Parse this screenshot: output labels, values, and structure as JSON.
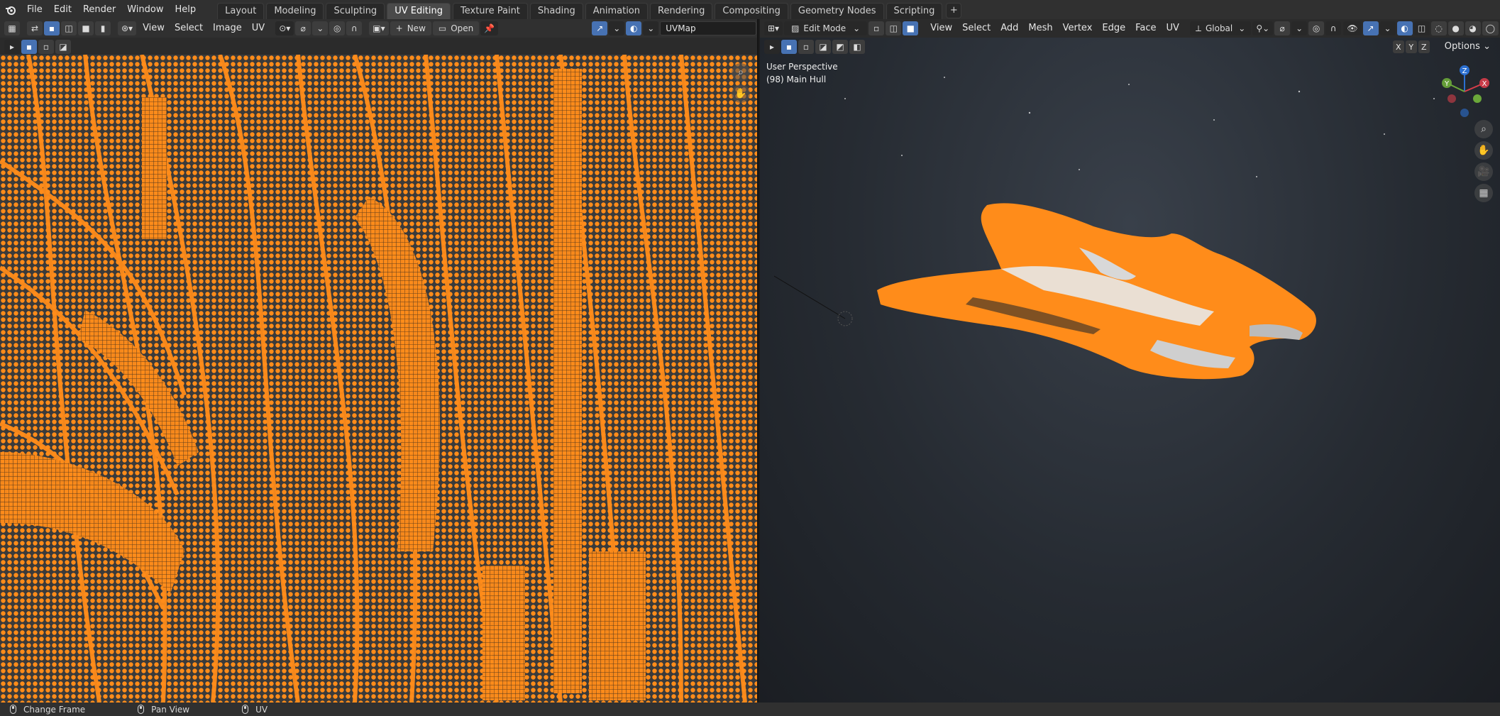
{
  "topbar": {
    "menus": [
      "File",
      "Edit",
      "Render",
      "Window",
      "Help"
    ],
    "workspaces": [
      "Layout",
      "Modeling",
      "Sculpting",
      "UV Editing",
      "Texture Paint",
      "Shading",
      "Animation",
      "Rendering",
      "Compositing",
      "Geometry Nodes",
      "Scripting"
    ],
    "active_workspace": "UV Editing",
    "add_tab_label": "+"
  },
  "uv_editor": {
    "menus": [
      "View",
      "Select",
      "Image",
      "UV"
    ],
    "new_label": "New",
    "open_label": "Open",
    "uv_map_value": "UVMap"
  },
  "viewport": {
    "mode_label": "Edit Mode",
    "menus": [
      "View",
      "Select",
      "Add",
      "Mesh",
      "Vertex",
      "Edge",
      "Face",
      "UV"
    ],
    "transform_orientation": "Global",
    "perspective_label": "User Perspective",
    "object_label": "(98) Main Hull",
    "options_label": "Options",
    "axis_labels": [
      "X",
      "Y",
      "Z"
    ],
    "gizmo_axes": [
      "Z",
      "X",
      "Y"
    ]
  },
  "statusbar": {
    "items": [
      "Change Frame",
      "Pan View",
      "UV"
    ]
  },
  "colors": {
    "accent_orange": "#ff8c1a",
    "active_blue": "#4772b3",
    "background": "#1d1d1d"
  },
  "icons": [
    "blender-logo-icon",
    "editor-type-icon",
    "sync-selection-icon",
    "vertex-select-icon",
    "edge-select-icon",
    "face-select-icon",
    "island-select-icon",
    "sticky-mode-icon",
    "pivot-icon",
    "proportional-icon",
    "image-browse-icon",
    "pin-icon",
    "gizmo-icon",
    "overlay-icon",
    "zoom-icon",
    "hand-pan-icon",
    "camera-icon",
    "grid-icon",
    "mouse-left-icon",
    "mouse-middle-icon",
    "mouse-right-icon"
  ]
}
